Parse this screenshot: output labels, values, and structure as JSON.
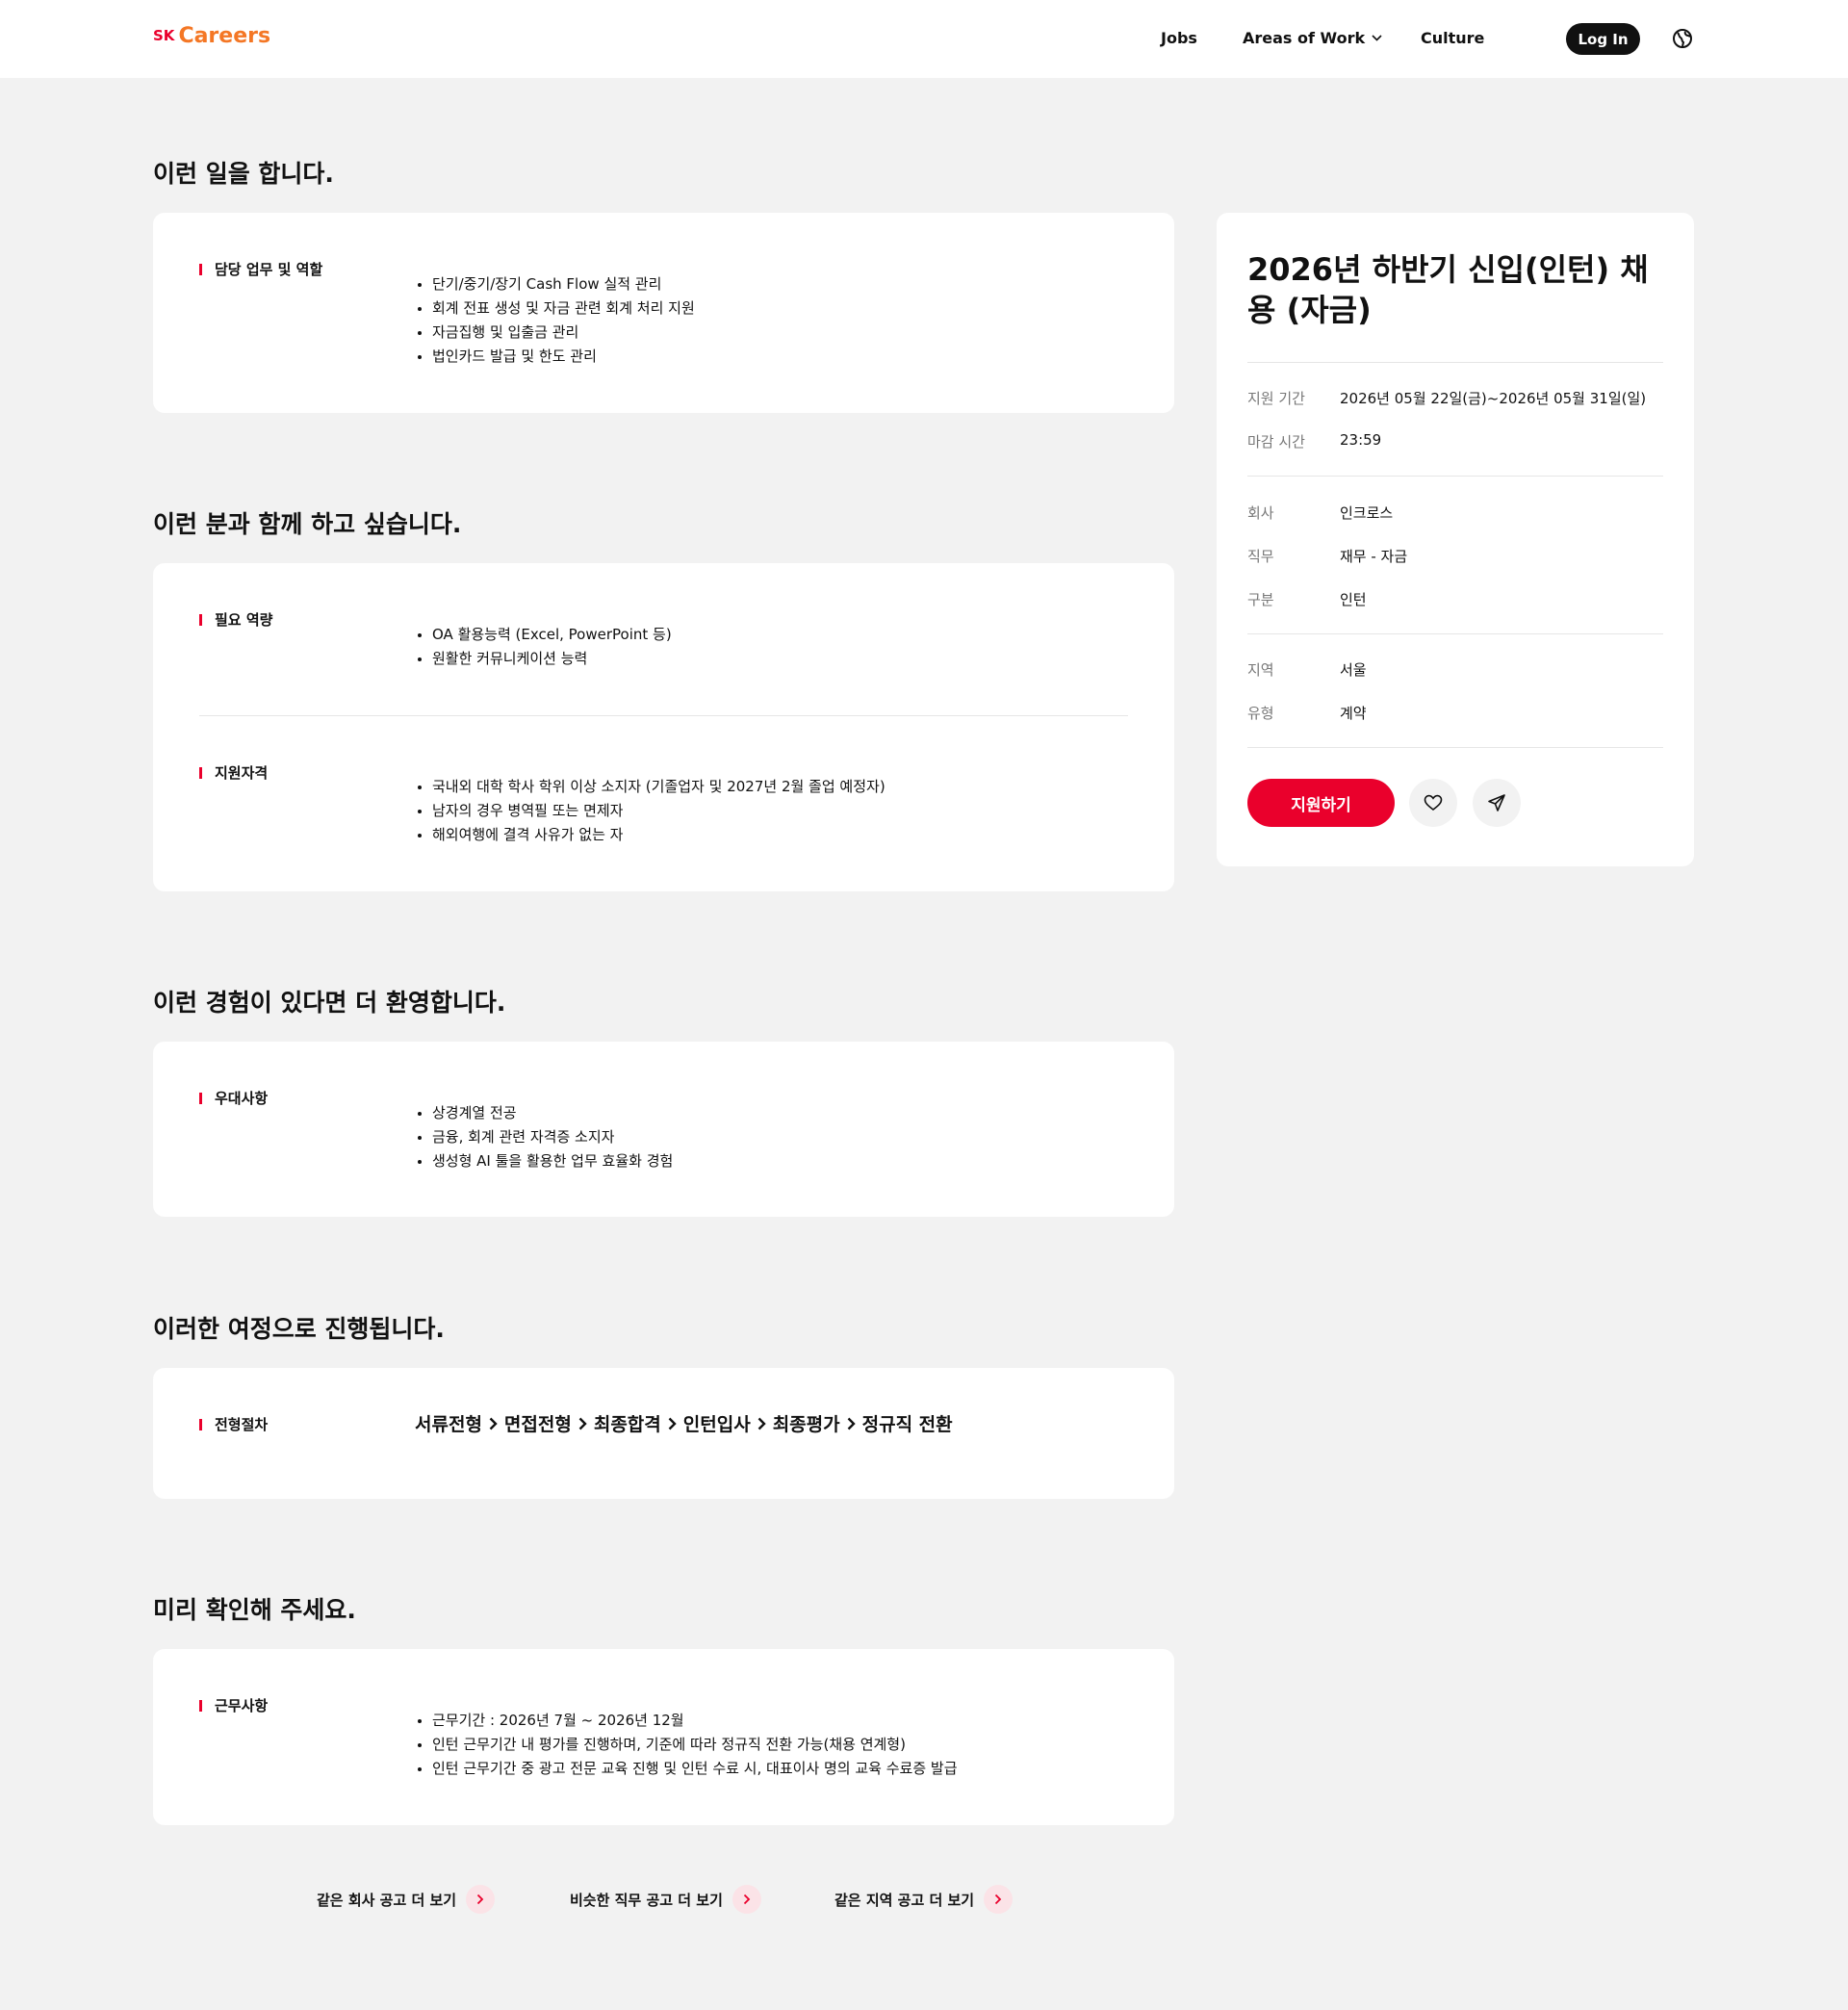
{
  "header": {
    "logo_sk": "SK",
    "logo_careers": "Careers",
    "nav": {
      "jobs": "Jobs",
      "areas": "Areas of Work",
      "culture": "Culture"
    },
    "login": "Log In",
    "icons": {
      "areas_dropdown": "chevron-down-icon",
      "language": "globe-icon"
    }
  },
  "sections": {
    "work": {
      "title": "이런 일을 합니다.",
      "label": "담당 업무 및 역할",
      "items": [
        "단기/중기/장기 Cash Flow 실적 관리",
        "회계 전표 생성 및 자금 관련 회계 처리 지원",
        "자금집행 및 입출금 관리",
        "법인카드 발급 및 한도 관리"
      ]
    },
    "want": {
      "title": "이런 분과 함께 하고 싶습니다.",
      "skills_label": "필요 역량",
      "skills": [
        "OA 활용능력 (Excel, PowerPoint 등)",
        "원활한 커뮤니케이션 능력"
      ],
      "qual_label": "지원자격",
      "quals": [
        "국내외 대학 학사 학위 이상 소지자 (기졸업자 및 2027년 2월 졸업 예정자)",
        "남자의 경우 병역필 또는 면제자",
        "해외여행에 결격 사유가 없는 자"
      ]
    },
    "pref": {
      "title": "이런 경험이 있다면 더 환영합니다.",
      "label": "우대사항",
      "items": [
        "상경계열 전공",
        "금융, 회계 관련 자격증 소지자",
        "생성형 AI 툴을 활용한 업무 효율화 경험"
      ]
    },
    "process": {
      "title": "이러한 여정으로 진행됩니다.",
      "label": "전형절차",
      "steps": [
        "서류전형",
        "면접전형",
        "최종합격",
        "인턴입사",
        "최종평가",
        "정규직 전환"
      ]
    },
    "notice": {
      "title": "미리 확인해 주세요.",
      "label": "근무사항",
      "items": [
        "근무기간 : 2026년 7월 ~ 2026년 12월",
        "인턴 근무기간 내 평가를 진행하며, 기준에 따라 정규직 전환 가능(채용 연계형)",
        "인턴 근무기간 중 광고 전문 교육 진행 및 인턴 수료 시, 대표이사 명의 교육 수료증 발급"
      ]
    }
  },
  "sidebar": {
    "title": "2026년 하반기 신입(인턴) 채용 (자금)",
    "period_key": "지원 기간",
    "period_val": "2026년 05월 22일(금)~2026년 05월 31일(일)",
    "deadline_key": "마감 시간",
    "deadline_val": "23:59",
    "company_key": "회사",
    "company_val": "인크로스",
    "job_key": "직무",
    "job_val": "재무 - 자금",
    "type_key": "구분",
    "type_val": "인턴",
    "region_key": "지역",
    "region_val": "서울",
    "contract_key": "유형",
    "contract_val": "계약",
    "apply": "지원하기",
    "icons": {
      "like": "heart-icon",
      "share": "send-icon"
    }
  },
  "bottom_links": {
    "company": "같은 회사 공고 더 보기",
    "job": "비슷한 직무 공고 더 보기",
    "region": "같은 지역 공고 더 보기"
  },
  "colors": {
    "brand_red": "#ea002c",
    "brand_orange": "#f47725",
    "background": "#f2f2f2"
  }
}
